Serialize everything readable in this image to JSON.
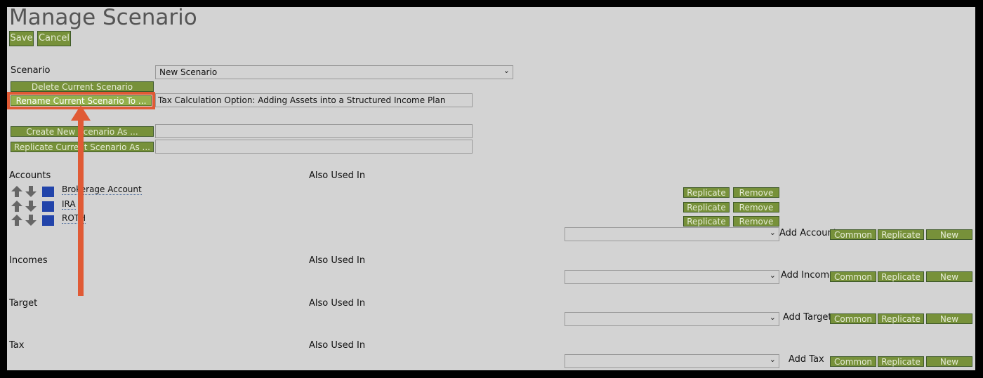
{
  "page": {
    "title": "Manage Scenario"
  },
  "toolbar": {
    "save_label": "Save",
    "cancel_label": "Cancel"
  },
  "scenario": {
    "label": "Scenario",
    "selected": "New Scenario",
    "delete_label": "Delete Current Scenario",
    "rename_label": "Rename Current Scenario To ...",
    "rename_value": "Tax Calculation Option: Adding Assets into a Structured Income Plan",
    "create_label": "Create New Scenario As ...",
    "create_value": "",
    "replicate_label": "Replicate Current Scenario As ...",
    "replicate_value": ""
  },
  "sections": {
    "also_used_in": "Also Used In",
    "accounts": {
      "label": "Accounts",
      "add_label": "Add Account",
      "items": [
        {
          "name": "Brokerage Account",
          "color": "#2244aa"
        },
        {
          "name": "IRA",
          "color": "#2244aa"
        },
        {
          "name": "ROTH",
          "color": "#2244aa"
        }
      ]
    },
    "incomes": {
      "label": "Incomes",
      "add_label": "Add Income"
    },
    "target": {
      "label": "Target",
      "add_label": "Add Target"
    },
    "tax": {
      "label": "Tax",
      "add_label": "Add Tax"
    }
  },
  "buttons": {
    "replicate": "Replicate",
    "remove": "Remove",
    "common": "Common",
    "new": "New"
  },
  "colors": {
    "button_bg": "#77913a",
    "highlight": "#e05a35",
    "panel_bg": "#d3d3d3"
  }
}
